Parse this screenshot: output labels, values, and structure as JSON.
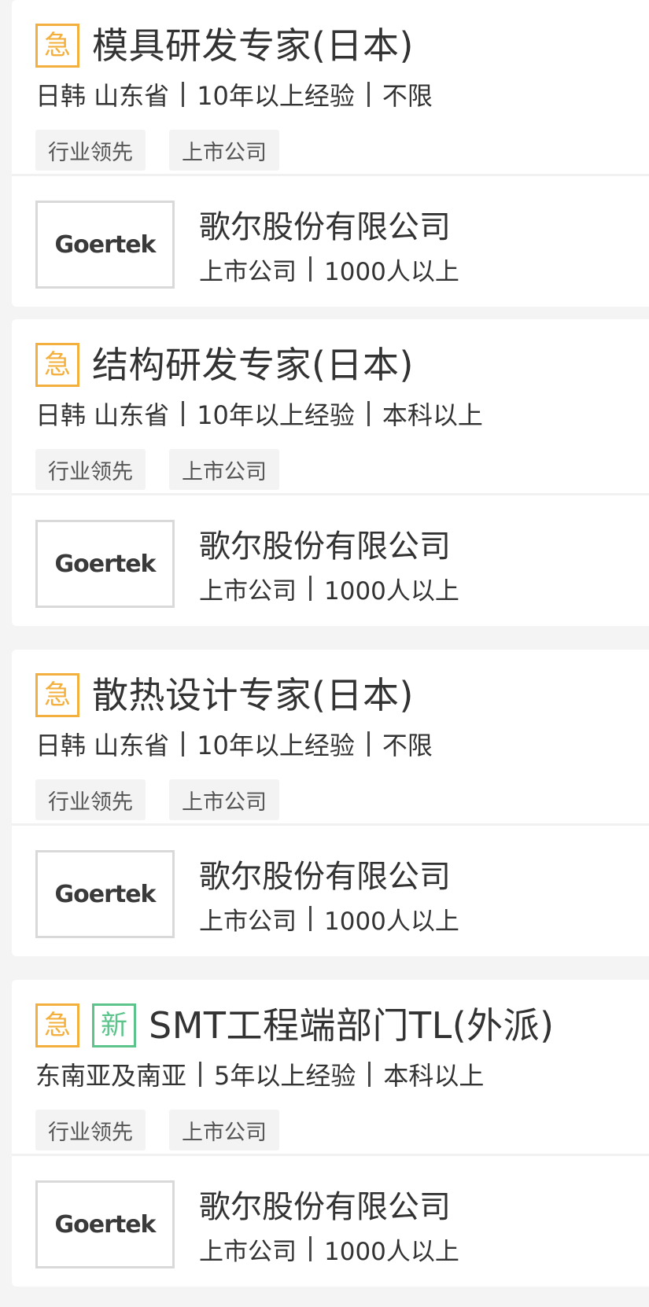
{
  "jobs": [
    {
      "badges": [
        "急"
      ],
      "title": "模具研发专家(日本)",
      "location": "日韩 山东省",
      "experience": "10年以上经验",
      "education": "不限",
      "tags": [
        "行业领先",
        "上市公司"
      ],
      "company": {
        "logo_text": "Goertek",
        "name": "歌尔股份有限公司",
        "type": "上市公司",
        "size": "1000人以上"
      }
    },
    {
      "badges": [
        "急"
      ],
      "title": "结构研发专家(日本)",
      "location": "日韩 山东省",
      "experience": "10年以上经验",
      "education": "本科以上",
      "tags": [
        "行业领先",
        "上市公司"
      ],
      "company": {
        "logo_text": "Goertek",
        "name": "歌尔股份有限公司",
        "type": "上市公司",
        "size": "1000人以上"
      }
    },
    {
      "badges": [
        "急"
      ],
      "title": "散热设计专家(日本)",
      "location": "日韩 山东省",
      "experience": "10年以上经验",
      "education": "不限",
      "tags": [
        "行业领先",
        "上市公司"
      ],
      "company": {
        "logo_text": "Goertek",
        "name": "歌尔股份有限公司",
        "type": "上市公司",
        "size": "1000人以上"
      }
    },
    {
      "badges": [
        "急",
        "新"
      ],
      "title": "SMT工程端部门TL(外派)",
      "location": "东南亚及南亚",
      "experience": "5年以上经验",
      "education": "本科以上",
      "tags": [
        "行业领先",
        "上市公司"
      ],
      "company": {
        "logo_text": "Goertek",
        "name": "歌尔股份有限公司",
        "type": "上市公司",
        "size": "1000人以上"
      }
    }
  ],
  "colors": {
    "urgent": "#f3b03e",
    "new": "#5cc48b",
    "background": "#f4f4f4",
    "chip_bg": "#f3f3f3"
  }
}
